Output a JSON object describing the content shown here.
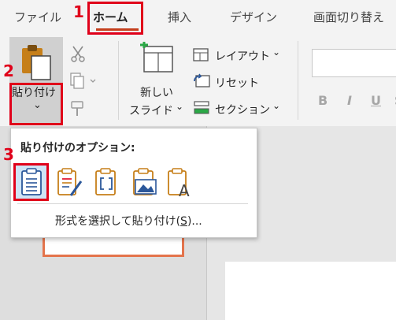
{
  "tabs": [
    {
      "label": "ファイル"
    },
    {
      "label": "ホーム"
    },
    {
      "label": "挿入"
    },
    {
      "label": "デザイン"
    },
    {
      "label": "画面切り替え"
    }
  ],
  "steps": [
    "1",
    "2",
    "3"
  ],
  "ribbon": {
    "paste_label": "貼り付け",
    "paste_chevron": "⌄",
    "new_slide_line1": "新しい",
    "new_slide_line2": "スライド",
    "layout_label": "レイアウト",
    "reset_label": "リセット",
    "section_label": "セクション",
    "chevron": "⌄",
    "bold": "B",
    "italic": "I",
    "underline": "U",
    "strike": "S"
  },
  "paste_popup": {
    "title": "貼り付けのオプション:",
    "paste_special_prefix": "形式を選択して貼り付け(",
    "paste_special_key": "S",
    "paste_special_suffix": ")..."
  },
  "colors": {
    "highlight_red": "#e0001a",
    "home_underline": "#c43e1c",
    "icon_blue": "#2b579a",
    "clipboard_orange": "#c67f19"
  }
}
